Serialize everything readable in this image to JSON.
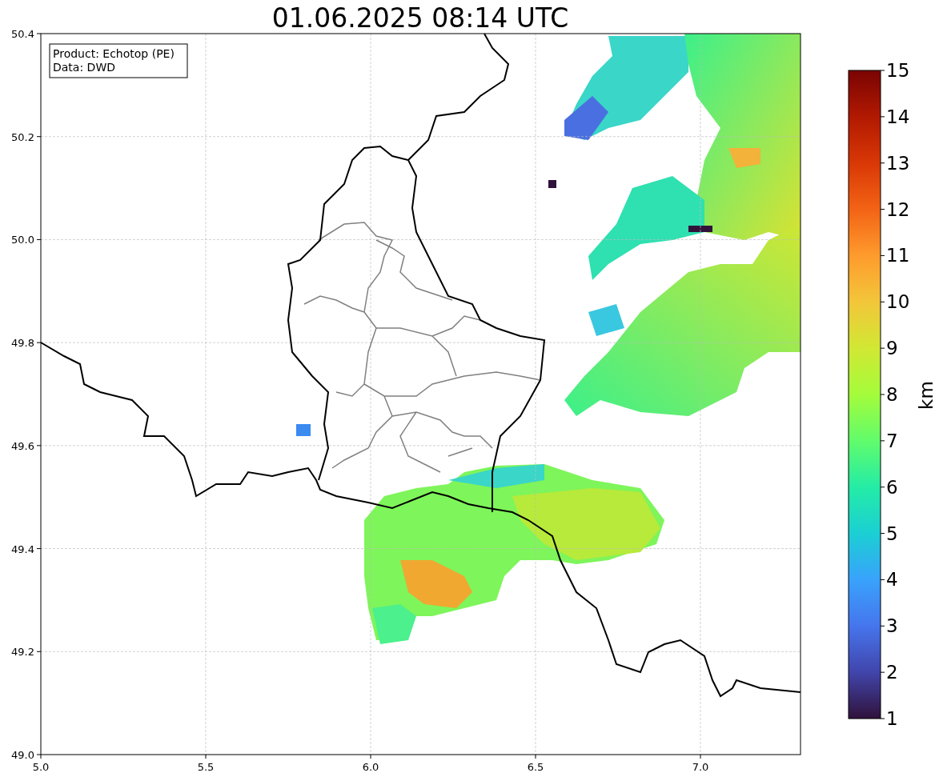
{
  "title": "01.06.2025 08:14 UTC",
  "info_box": [
    "Product: Echotop (PE)",
    "Data: DWD"
  ],
  "x_ticks": [
    "5.0",
    "5.5",
    "6.0",
    "6.5",
    "7.0"
  ],
  "y_ticks": [
    "50.4",
    "50.2",
    "50.0",
    "49.8",
    "49.6",
    "49.4",
    "49.2",
    "49.0"
  ],
  "colorbar": {
    "label": "km",
    "ticks": [
      "15",
      "14",
      "13",
      "12",
      "11",
      "10",
      "9",
      "8",
      "7",
      "6",
      "5",
      "4",
      "3",
      "2",
      "1"
    ]
  }
}
